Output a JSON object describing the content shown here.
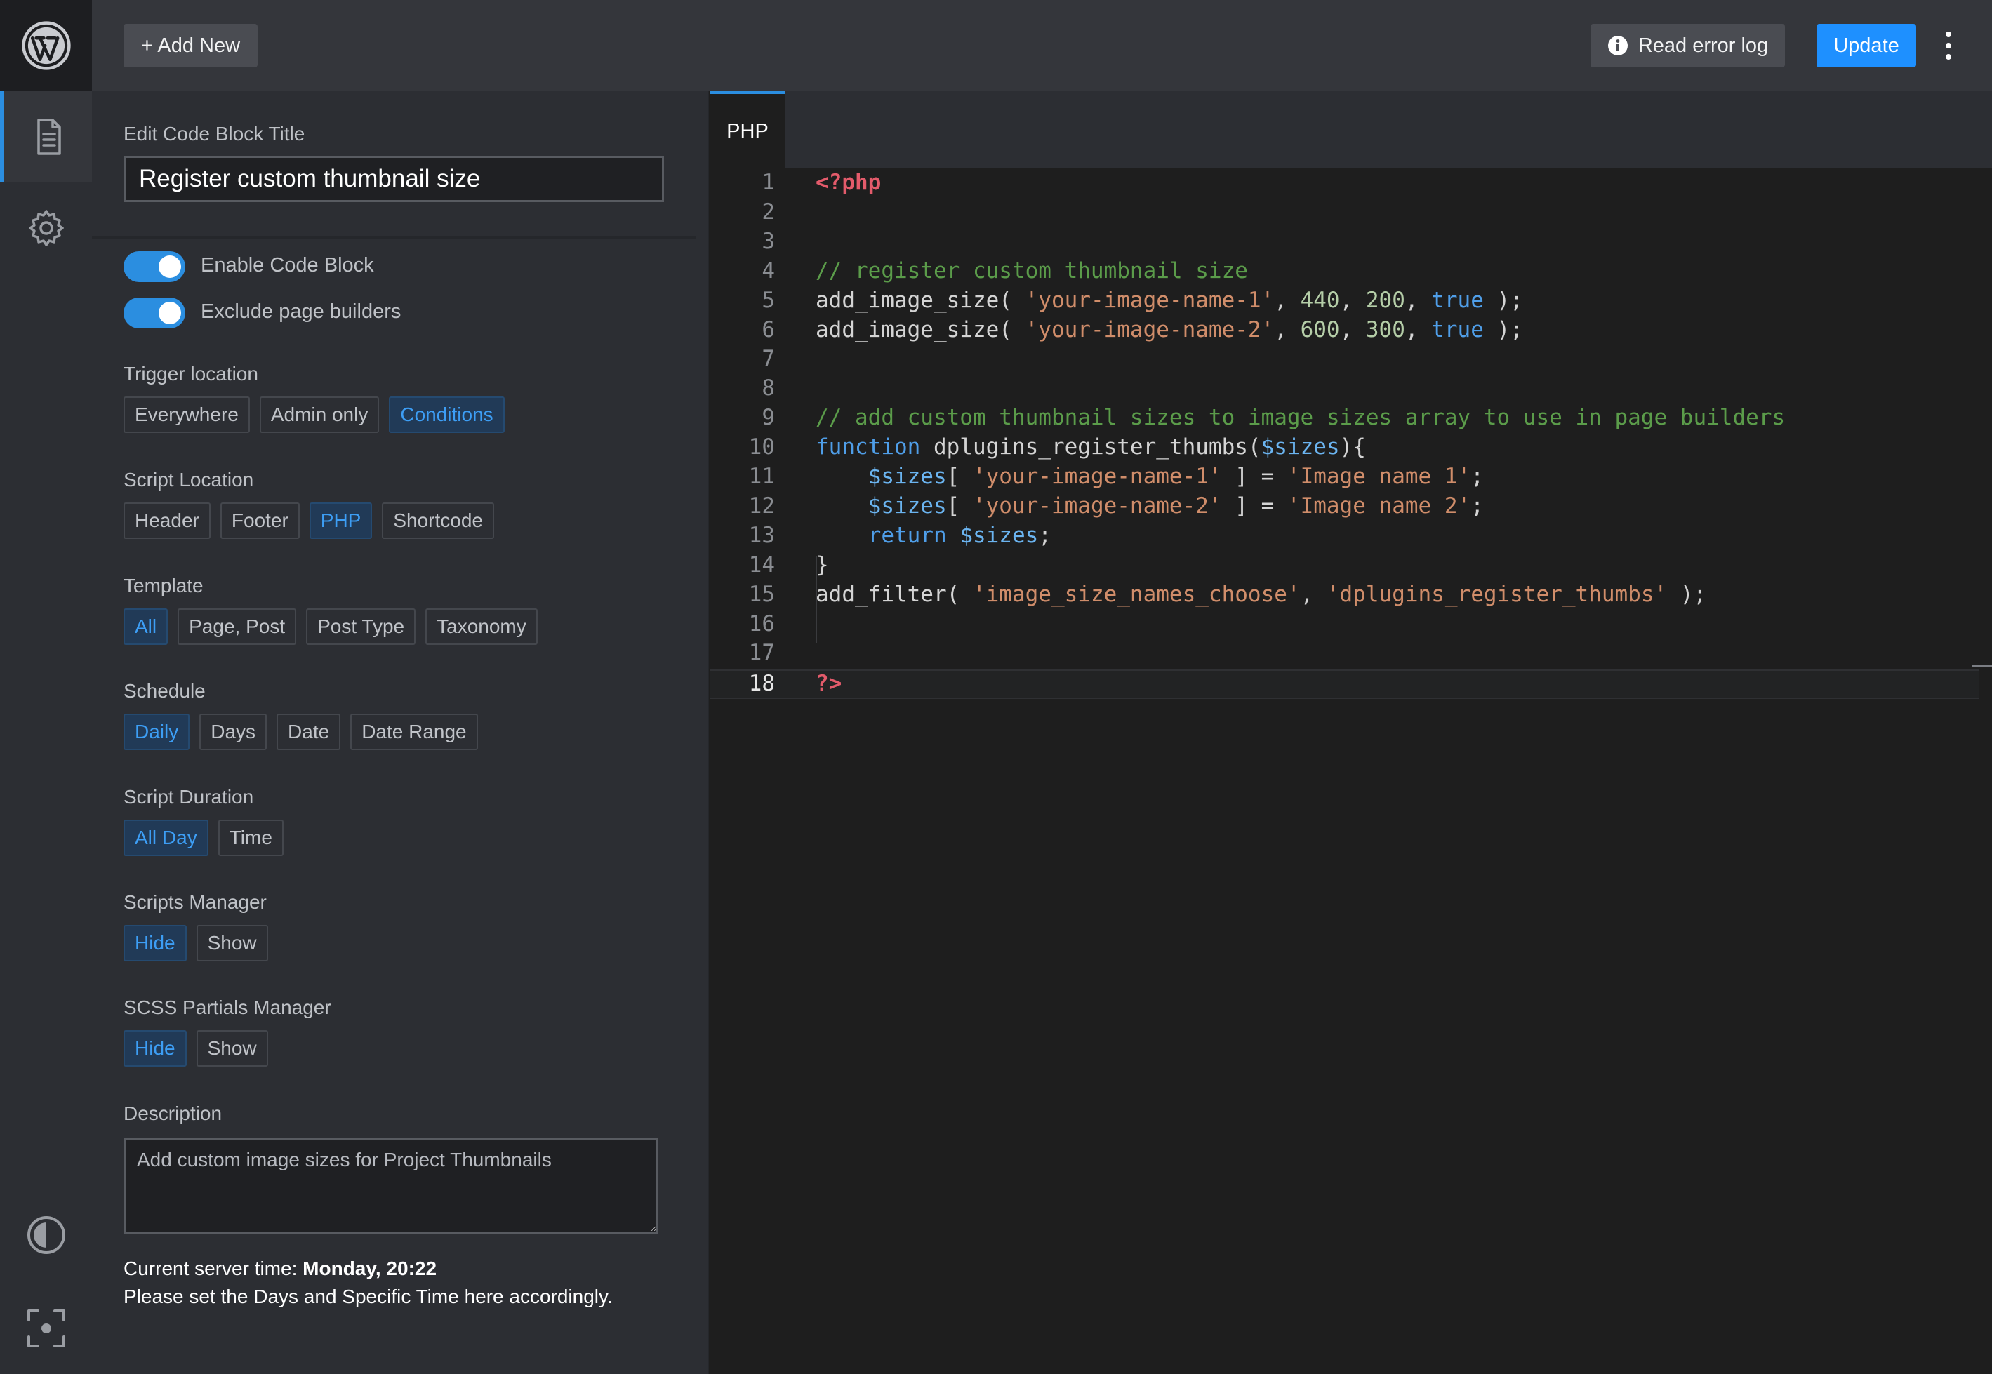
{
  "topbar": {
    "add_new_label": "+ Add New",
    "error_log_label": "Read error log",
    "update_label": "Update"
  },
  "panel": {
    "title_label": "Edit Code Block Title",
    "title_value": "Register custom thumbnail size",
    "toggles": [
      {
        "label": "Enable Code Block",
        "on": true
      },
      {
        "label": "Exclude page builders",
        "on": true
      }
    ],
    "groups": [
      {
        "label": "Trigger location",
        "options": [
          "Everywhere",
          "Admin only",
          "Conditions"
        ],
        "selected": "Conditions"
      },
      {
        "label": "Script Location",
        "options": [
          "Header",
          "Footer",
          "PHP",
          "Shortcode"
        ],
        "selected": "PHP"
      },
      {
        "label": "Template",
        "options": [
          "All",
          "Page, Post",
          "Post Type",
          "Taxonomy"
        ],
        "selected": "All"
      },
      {
        "label": "Schedule",
        "options": [
          "Daily",
          "Days",
          "Date",
          "Date Range"
        ],
        "selected": "Daily"
      },
      {
        "label": "Script Duration",
        "options": [
          "All Day",
          "Time"
        ],
        "selected": "All Day"
      },
      {
        "label": "Scripts Manager",
        "options": [
          "Hide",
          "Show"
        ],
        "selected": "Hide"
      },
      {
        "label": "SCSS Partials Manager",
        "options": [
          "Hide",
          "Show"
        ],
        "selected": "Hide"
      }
    ],
    "description_label": "Description",
    "description_value": "Add custom image sizes for Project Thumbnails",
    "server_time_prefix": "Current server time: ",
    "server_time_value": "Monday, 20:22",
    "server_time_note": "Please set the Days and Specific Time here accordingly."
  },
  "editor": {
    "tab_label": "PHP",
    "current_line": 18,
    "lines": [
      [
        [
          "tag",
          "<?php"
        ]
      ],
      [],
      [],
      [
        [
          "com",
          "// register custom thumbnail size"
        ]
      ],
      [
        [
          "plain",
          "add_image_size( "
        ],
        [
          "str",
          "'your-image-name-1'"
        ],
        [
          "plain",
          ", "
        ],
        [
          "num",
          "440"
        ],
        [
          "plain",
          ", "
        ],
        [
          "num",
          "200"
        ],
        [
          "plain",
          ", "
        ],
        [
          "kw",
          "true"
        ],
        [
          "plain",
          " );"
        ]
      ],
      [
        [
          "plain",
          "add_image_size( "
        ],
        [
          "str",
          "'your-image-name-2'"
        ],
        [
          "plain",
          ", "
        ],
        [
          "num",
          "600"
        ],
        [
          "plain",
          ", "
        ],
        [
          "num",
          "300"
        ],
        [
          "plain",
          ", "
        ],
        [
          "kw",
          "true"
        ],
        [
          "plain",
          " );"
        ]
      ],
      [],
      [],
      [
        [
          "com",
          "// add custom thumbnail sizes to image sizes array to use in page builders"
        ]
      ],
      [
        [
          "kw",
          "function"
        ],
        [
          "plain",
          " dplugins_register_thumbs("
        ],
        [
          "var",
          "$sizes"
        ],
        [
          "plain",
          "){"
        ]
      ],
      [
        [
          "plain",
          "    "
        ],
        [
          "var",
          "$sizes"
        ],
        [
          "plain",
          "[ "
        ],
        [
          "str",
          "'your-image-name-1'"
        ],
        [
          "plain",
          " ] = "
        ],
        [
          "str",
          "'Image name 1'"
        ],
        [
          "plain",
          ";"
        ]
      ],
      [
        [
          "plain",
          "    "
        ],
        [
          "var",
          "$sizes"
        ],
        [
          "plain",
          "[ "
        ],
        [
          "str",
          "'your-image-name-2'"
        ],
        [
          "plain",
          " ] = "
        ],
        [
          "str",
          "'Image name 2'"
        ],
        [
          "plain",
          ";"
        ]
      ],
      [
        [
          "plain",
          "    "
        ],
        [
          "kw",
          "return"
        ],
        [
          "plain",
          " "
        ],
        [
          "var",
          "$sizes"
        ],
        [
          "plain",
          ";"
        ]
      ],
      [
        [
          "plain",
          "}"
        ]
      ],
      [
        [
          "plain",
          "add_filter( "
        ],
        [
          "str",
          "'image_size_names_choose'"
        ],
        [
          "plain",
          ", "
        ],
        [
          "str",
          "'dplugins_register_thumbs'"
        ],
        [
          "plain",
          " );"
        ]
      ],
      [],
      [],
      [
        [
          "tag",
          "?>"
        ]
      ]
    ]
  },
  "icons": {
    "logo": "wordpress-logo",
    "rail": [
      "document-icon",
      "gear-icon",
      "contrast-icon",
      "focus-icon"
    ],
    "error_log": "info-icon",
    "menu": "kebab-menu-icon"
  },
  "colors": {
    "accent": "#1e90ff",
    "selected_text": "#3d9ef5",
    "selected_bg": "#213a57"
  }
}
